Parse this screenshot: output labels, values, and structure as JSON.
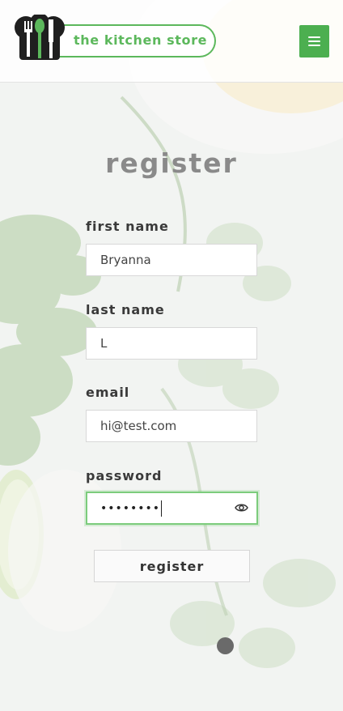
{
  "header": {
    "brand_name": "the kitchen store",
    "menu_icon": "hamburger-icon",
    "logo_icon": "chef-hat-utensils-icon"
  },
  "form": {
    "title": "register",
    "fields": [
      {
        "label": "first name",
        "value": "Bryanna"
      },
      {
        "label": "last name",
        "value": "L"
      },
      {
        "label": "email",
        "value": "hi@test.com"
      },
      {
        "label": "password",
        "value": "••••••••",
        "reveal_icon": "eye-icon"
      }
    ],
    "submit_label": "register"
  },
  "colors": {
    "brand_green": "#5cb85c",
    "menu_button": "#4caf50",
    "focus_ring": "#7ccc7c"
  }
}
